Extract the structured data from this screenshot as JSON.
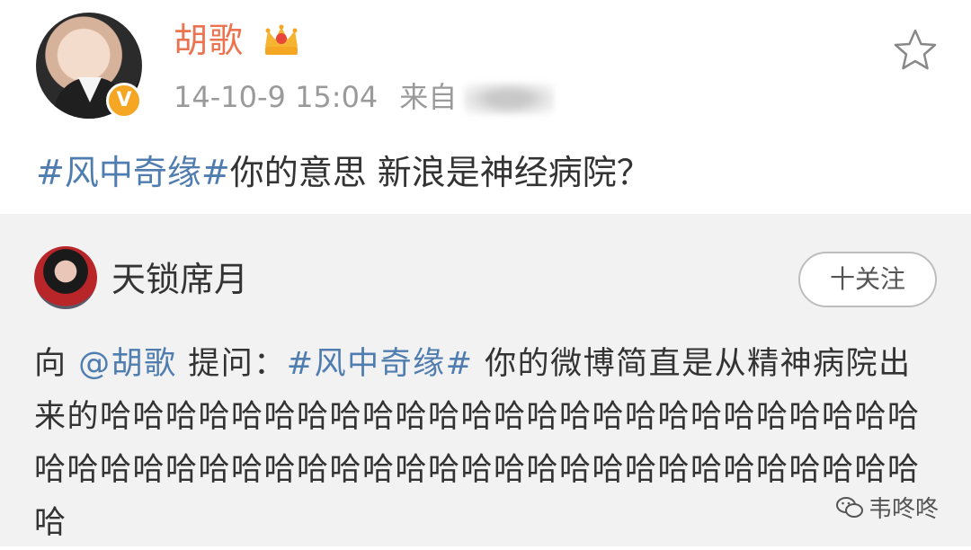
{
  "post": {
    "username": "胡歌",
    "verified_badge": "V",
    "crown_icon": "crown-icon",
    "time": "14-10-9 15:04",
    "source_prefix": "来自",
    "star_icon": "star-outline-icon",
    "topic": "#风中奇缘#",
    "text": "你的意思 新浪是神经病院？"
  },
  "repost": {
    "username": "天锁席月",
    "follow_label": "十关注",
    "prefix": "向 ",
    "mention": "@胡歌",
    "ask": " 提问：",
    "topic": "#风中奇缘#",
    "body": " 你的微博简直是从精神病院出来的哈哈哈哈哈哈哈哈哈哈哈哈哈哈哈哈哈哈哈哈哈哈哈哈哈哈哈哈哈哈哈哈哈哈哈哈哈哈哈哈哈哈哈哈哈哈哈哈哈哈哈哈哈"
  },
  "watermark": {
    "icon": "wechat-icon",
    "text": "韦咚咚"
  },
  "colors": {
    "username_orange": "#eb7350",
    "link_blue": "#507daf",
    "meta_gray": "#9a9a9a",
    "repost_bg": "#f2f2f2"
  }
}
